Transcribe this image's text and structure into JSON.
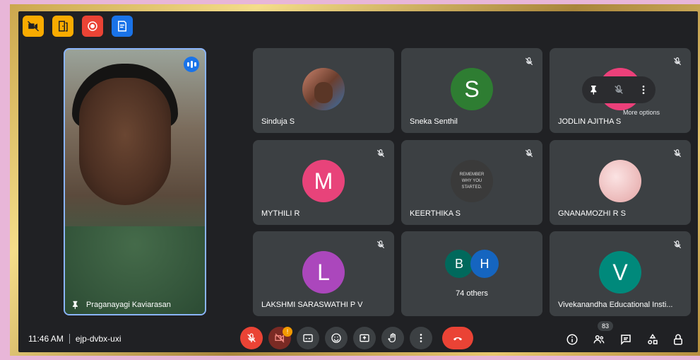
{
  "self_tile": {
    "name": "Praganayagi Kaviarasan"
  },
  "tiles": [
    {
      "name": "Sinduja S",
      "avatar": "photo",
      "color": "#e0a060"
    },
    {
      "name": "Sneka Senthil",
      "initial": "S",
      "color": "#2e7d32"
    },
    {
      "name": "JODLIN AJITHA S",
      "initial": "",
      "color": "#ec407a"
    },
    {
      "name": "MYTHILI R",
      "initial": "M",
      "color": "#e8437a"
    },
    {
      "name": "KEERTHIKA S",
      "avatar": "photo",
      "photo_text": "REMEMBER WHY YOU STARTED.",
      "color": "#555555"
    },
    {
      "name": "GNANAMOZHI R S",
      "avatar": "photo",
      "color": "#f3c4c4"
    },
    {
      "name": "LAKSHMI SARASWATHI P V",
      "initial": "L",
      "color": "#ab47bc"
    },
    {
      "name": "Vivekanandha Educational Insti...",
      "initial": "V",
      "color": "#00897b"
    }
  ],
  "others": {
    "initials": [
      "B",
      "H"
    ],
    "colors": [
      "#00695c",
      "#1565c0"
    ],
    "label": "74 others"
  },
  "hover_menu": {
    "tooltip": "More options"
  },
  "bottom": {
    "time": "11:46 AM",
    "meeting_code": "ejp-dvbx-uxi",
    "notification_badge": "!",
    "participants_count": "83"
  },
  "colors": {
    "accent": "#8ab4f8",
    "danger": "#ea4335",
    "surface": "#3c4043",
    "background": "#202124"
  },
  "icons": [
    "camera-off-icon",
    "door-icon",
    "record-icon",
    "notes-icon",
    "mic-off-icon",
    "pin-icon",
    "more-vert-icon",
    "captions-icon",
    "emoji-icon",
    "present-icon",
    "raise-hand-icon",
    "end-call-icon",
    "info-icon",
    "people-icon",
    "chat-icon",
    "activities-icon",
    "lock-icon"
  ]
}
